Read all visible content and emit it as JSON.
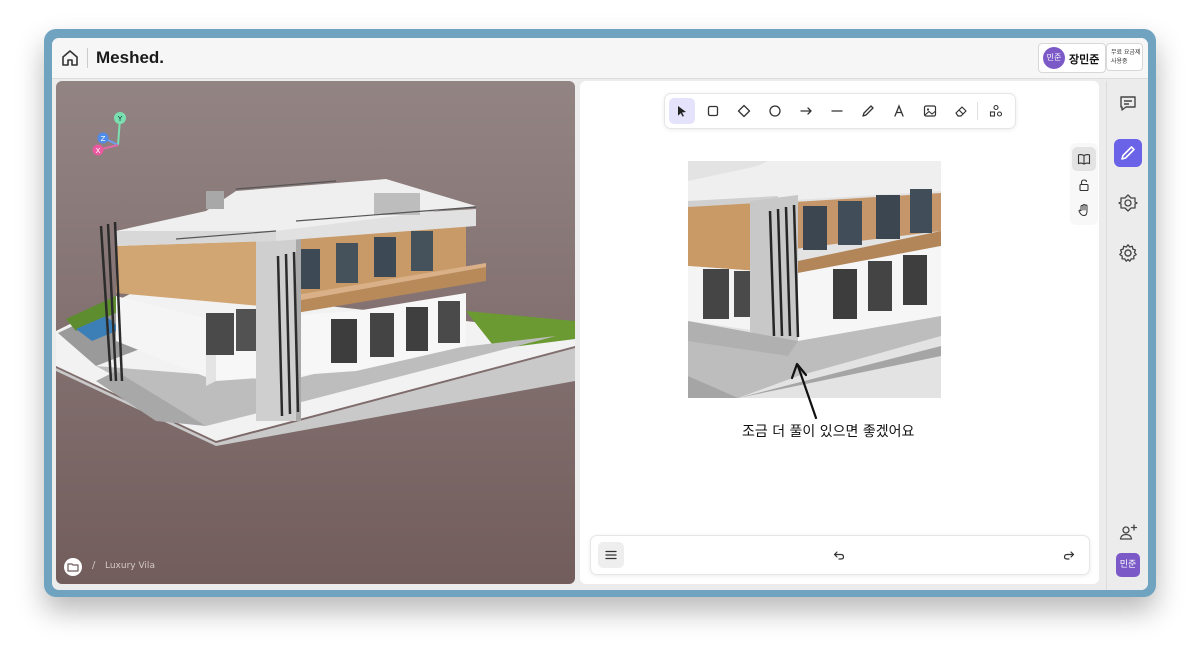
{
  "header": {
    "brand": "Meshed.",
    "user": {
      "avatar_text": "민준",
      "name": "장민준"
    },
    "plan": {
      "line1": "무료 요금제",
      "line2": "사용중"
    }
  },
  "viewer": {
    "breadcrumb": {
      "separator": "/",
      "project": "Luxury Vila"
    },
    "axes": {
      "y": "Y",
      "z": "Z",
      "x": "X"
    }
  },
  "canvas": {
    "toolbar": [
      "select-tool",
      "rectangle-tool",
      "diamond-tool",
      "ellipse-tool",
      "arrow-tool",
      "line-tool",
      "pencil-tool",
      "text-tool",
      "image-tool",
      "eraser-tool",
      "shapes-library-tool"
    ],
    "active_tool": "select-tool",
    "side_tools": [
      "library-icon",
      "lock-icon",
      "hand-icon"
    ],
    "annotation_text": "조금 더 풀이 있으면 좋겠어요",
    "accent_color": "#6a63e8"
  },
  "right_sidebar": {
    "buttons": [
      "comment-icon",
      "edit-icon",
      "ai-icon",
      "settings-icon",
      "add-user-icon"
    ],
    "avatar_text": "민준"
  }
}
